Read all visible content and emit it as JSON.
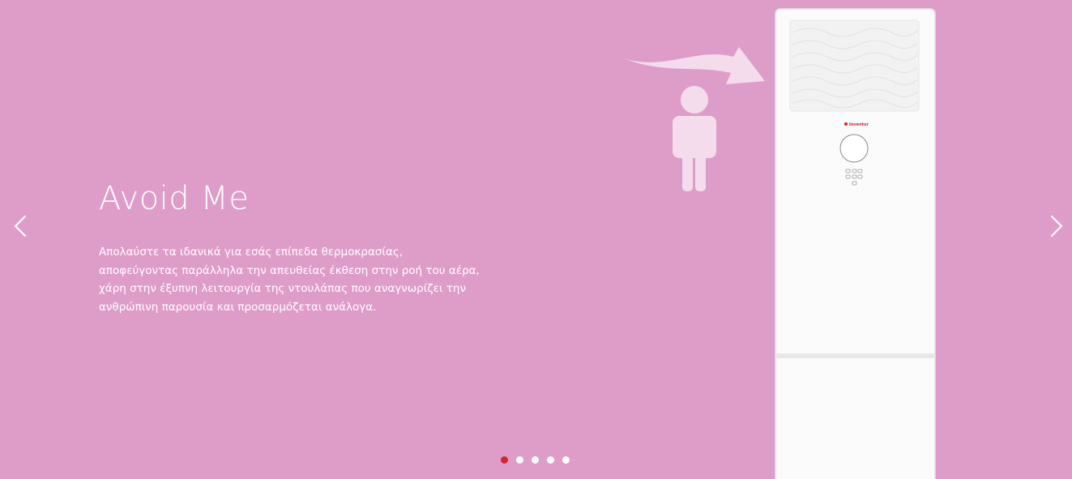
{
  "colors": {
    "background": "#de9dc9",
    "text": "#ffffff",
    "dot_active": "#d8232a",
    "dot_inactive": "#ffffff",
    "figure": "#f4dcec",
    "unit_body": "#fbfbfb",
    "unit_edge": "#e4e4e4",
    "brand": "#d8232a"
  },
  "slider": {
    "active_index": 0,
    "total_slides": 5,
    "slide": {
      "title": "Avoid Me",
      "description_lines": [
        "Απολαύστε τα ιδανικά για εσάς επίπεδα θερμοκρασίας,",
        "αποφεύγοντας παράλληλα την απευθείας έκθεση στην ροή του αέρα,",
        "χάρη στην έξυπνη λειτουργία της ντουλάπας που αναγνωρίζει την",
        "ανθρώπινη παρουσία και προσαρμόζεται ανάλογα."
      ]
    },
    "unit_brand_label": "Inventor"
  },
  "icons": {
    "prev": "chevron-left-icon",
    "next": "chevron-right-icon",
    "person": "person-icon",
    "airflow": "curved-arrow-icon"
  }
}
